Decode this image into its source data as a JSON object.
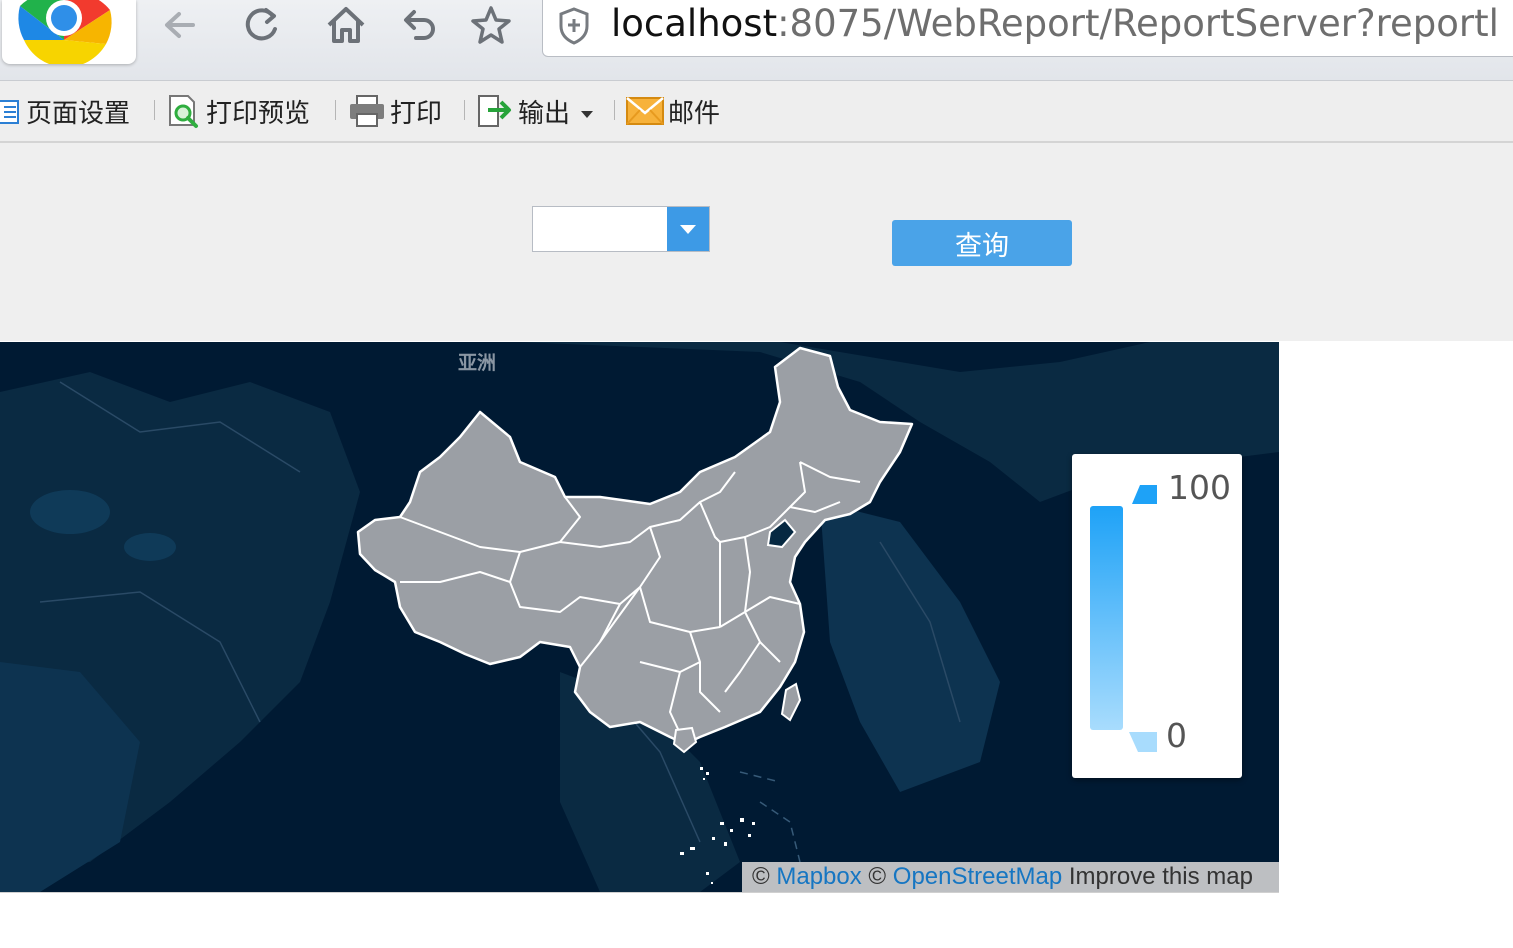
{
  "browser": {
    "url_host": "localhost",
    "url_rest": ":8075/WebReport/ReportServer?reportl"
  },
  "toolbar": {
    "items": [
      {
        "label": "页面设置",
        "icon": "page-setup-icon"
      },
      {
        "label": "打印预览",
        "icon": "print-preview-icon"
      },
      {
        "label": "打印",
        "icon": "printer-icon"
      },
      {
        "label": "输出",
        "icon": "export-icon"
      },
      {
        "label": "邮件",
        "icon": "mail-icon"
      }
    ]
  },
  "params": {
    "combo_value": "",
    "query_label": "查询"
  },
  "map": {
    "continent_label": "亚洲",
    "legend": {
      "max": "100",
      "min": "0",
      "color_high": "#1ea2f7",
      "color_low": "#a8dcfd"
    },
    "region_fill": "#9b9fa5",
    "background": "#001a33",
    "attribution": {
      "copy1": "©",
      "mapbox": "Mapbox",
      "copy2": "©",
      "osm": "OpenStreetMap",
      "improve": "Improve this map"
    }
  }
}
